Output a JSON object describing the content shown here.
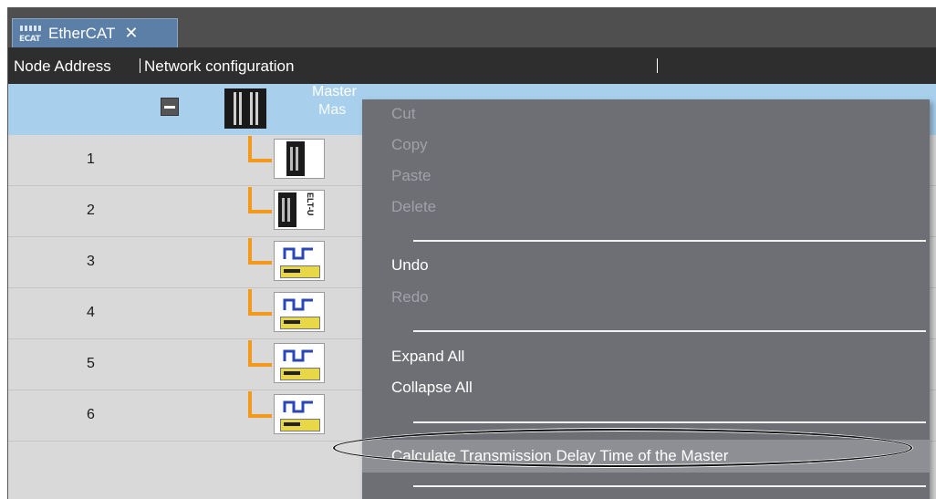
{
  "tab": {
    "icon_text": "ECAT",
    "label": "EtherCAT",
    "close_glyph": "✕"
  },
  "columns": {
    "node_address": "Node Address",
    "network_configuration": "Network configuration"
  },
  "master": {
    "label": "Master",
    "sub_label": "Mas"
  },
  "slaves": [
    {
      "node": "1",
      "device_type": "coupler"
    },
    {
      "node": "2",
      "device_type": "elt-unit",
      "text": "ELT-U"
    },
    {
      "node": "3",
      "device_type": "servo-drive"
    },
    {
      "node": "4",
      "device_type": "servo-drive"
    },
    {
      "node": "5",
      "device_type": "servo-drive"
    },
    {
      "node": "6",
      "device_type": "servo-drive"
    }
  ],
  "context_menu": {
    "items": [
      {
        "label": "Cut",
        "enabled": false
      },
      {
        "label": "Copy",
        "enabled": false
      },
      {
        "label": "Paste",
        "enabled": false
      },
      {
        "label": "Delete",
        "enabled": false
      },
      {
        "label": "Undo",
        "enabled": true
      },
      {
        "label": "Redo",
        "enabled": false
      },
      {
        "label": "Expand All",
        "enabled": true
      },
      {
        "label": "Collapse All",
        "enabled": true
      },
      {
        "label": "Calculate Transmission Delay Time of the Master",
        "enabled": true,
        "highlighted": true
      }
    ]
  },
  "colors": {
    "tab_bg": "#5b7fa6",
    "header_bg": "#2e2e2e",
    "selected_row": "#a8d0ec",
    "menu_bg": "#6d6f75",
    "connector": "#f39a1c"
  }
}
